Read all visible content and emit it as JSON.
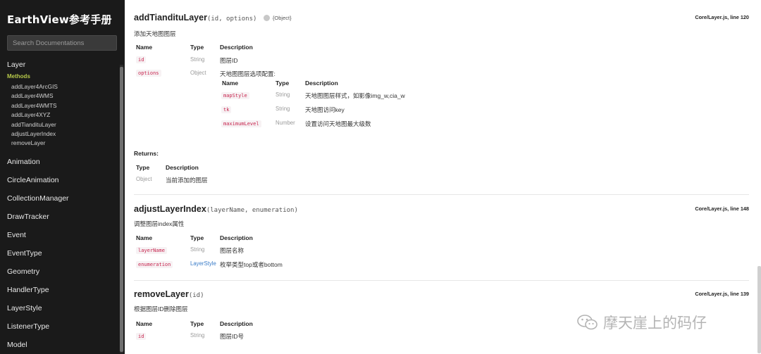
{
  "sidebar": {
    "brand": "EarthView参考手册",
    "search_placeholder": "Search Documentations",
    "current": {
      "title": "Layer",
      "methods_label": "Methods",
      "methods": [
        "addLayer4ArcGIS",
        "addLayer4WMS",
        "addLayer4WMTS",
        "addLayer4XYZ",
        "addTiandituLayer",
        "adjustLayerIndex",
        "removeLayer"
      ]
    },
    "items": [
      "Animation",
      "CircleAnimation",
      "CollectionManager",
      "DrawTracker",
      "Event",
      "EventType",
      "Geometry",
      "HandlerType",
      "LayerStyle",
      "ListenerType",
      "Model"
    ]
  },
  "main": {
    "tianditu": {
      "name": "addTiandituLayer",
      "signature": "(id, options)",
      "return_badge": "{Object}",
      "source": "Core/Layer.js, line 120",
      "description": "添加天地图图层",
      "headers": {
        "name": "Name",
        "type": "Type",
        "description": "Description"
      },
      "params": [
        {
          "name": "id",
          "type": "String",
          "description": "图层ID"
        },
        {
          "name": "options",
          "type": "Object",
          "description": "天地图图层选项配置:"
        }
      ],
      "sub_params": [
        {
          "name": "mapStyle",
          "type": "String",
          "description": "天地图图层样式，如影像img_w,cia_w"
        },
        {
          "name": "tk",
          "type": "String",
          "description": "天地图访问key"
        },
        {
          "name": "maximumLevel",
          "type": "Number",
          "description": "设置访问天地图最大级数"
        }
      ],
      "returns_label": "Returns:",
      "returns_headers": {
        "type": "Type",
        "description": "Description"
      },
      "returns": {
        "type": "Object",
        "description": "当前添加的图层"
      }
    },
    "adjust": {
      "name": "adjustLayerIndex",
      "signature": "(layerName, enumeration)",
      "source": "Core/Layer.js, line 148",
      "description": "调整图层index属性",
      "headers": {
        "name": "Name",
        "type": "Type",
        "description": "Description"
      },
      "params": [
        {
          "name": "layerName",
          "type": "String",
          "description": "图层名称"
        },
        {
          "name": "enumeration",
          "type": "LayerStyle",
          "description": "枚举类型top或者bottom"
        }
      ]
    },
    "remove": {
      "name": "removeLayer",
      "signature": "(id)",
      "source": "Core/Layer.js, line 139",
      "description": "根据图层ID删除图层",
      "headers": {
        "name": "Name",
        "type": "Type",
        "description": "Description"
      },
      "params": [
        {
          "name": "id",
          "type": "String",
          "description": "图层ID号"
        }
      ]
    }
  },
  "watermark": "摩天崖上的码仔",
  "colors": {
    "sidebar_bg": "#1a1a1a",
    "methods_label": "#b7c94a",
    "code_text": "#c7254e",
    "link": "#3a7cc8"
  }
}
